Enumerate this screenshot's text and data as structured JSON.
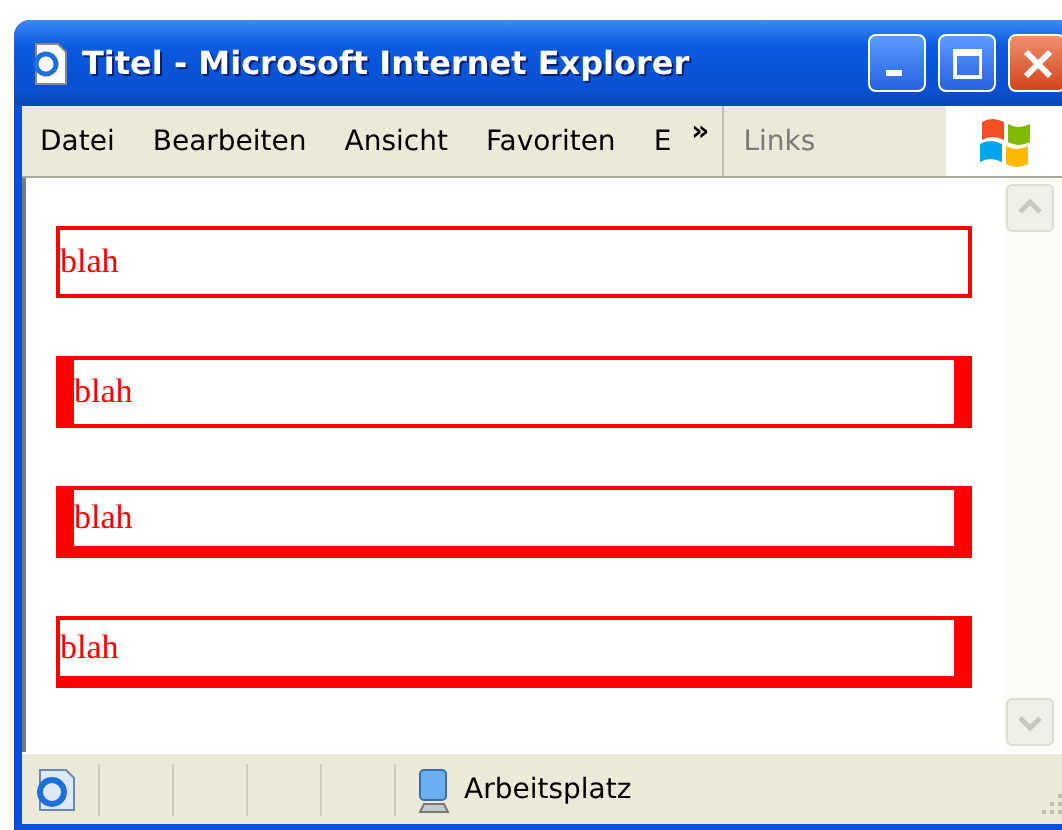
{
  "window": {
    "title": "Titel - Microsoft Internet Explorer"
  },
  "menu": [
    {
      "label": "Datei"
    },
    {
      "label": "Bearbeiten"
    },
    {
      "label": "Ansicht"
    },
    {
      "label": "Favoriten"
    },
    {
      "label": "E"
    }
  ],
  "menu_overflow": "»",
  "links_label": "Links",
  "boxes": [
    {
      "text": "blah",
      "kind": "thin"
    },
    {
      "text": "blah",
      "kind": "thick-sides"
    },
    {
      "text": "blah",
      "kind": "thick-sides-bottom"
    },
    {
      "text": "blah",
      "kind": "thick-right-bottom"
    }
  ],
  "status_bar": {
    "zone": "Arbeitsplatz"
  }
}
